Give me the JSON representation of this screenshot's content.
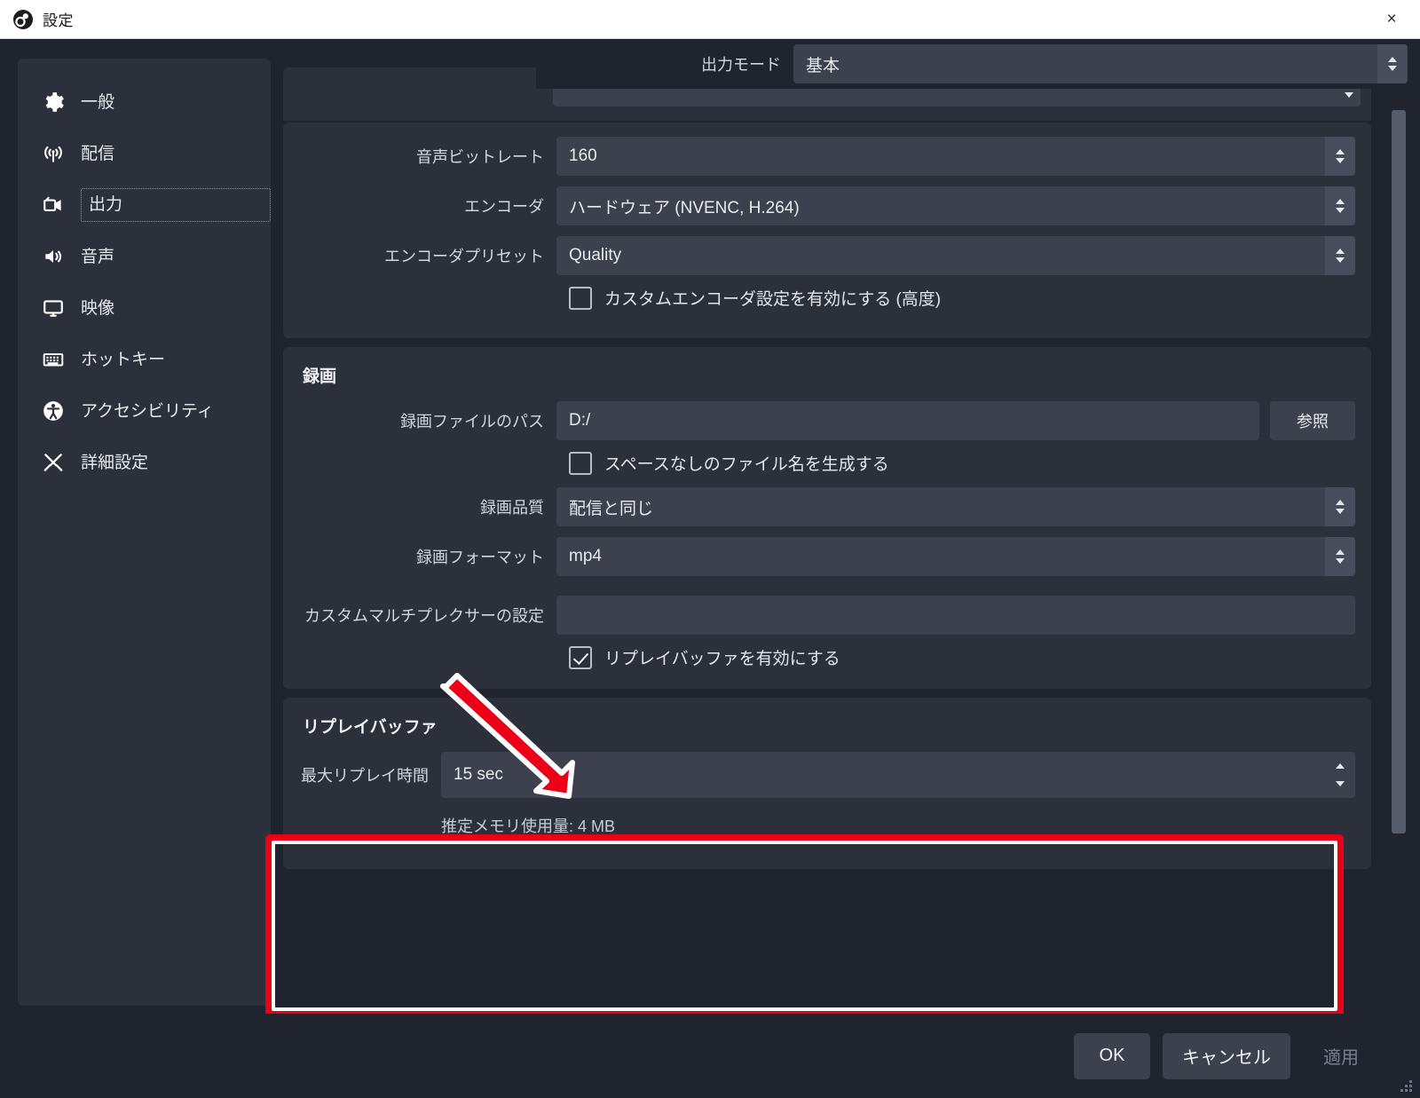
{
  "window": {
    "title": "設定",
    "app_icon": "obs-logo-icon",
    "close_label": "×"
  },
  "sidebar": {
    "items": [
      {
        "label": "一般",
        "icon": "gear-icon",
        "selected": false
      },
      {
        "label": "配信",
        "icon": "broadcast-icon",
        "selected": false
      },
      {
        "label": "出力",
        "icon": "output-camera-icon",
        "selected": true
      },
      {
        "label": "音声",
        "icon": "speaker-icon",
        "selected": false
      },
      {
        "label": "映像",
        "icon": "monitor-icon",
        "selected": false
      },
      {
        "label": "ホットキー",
        "icon": "keyboard-icon",
        "selected": false
      },
      {
        "label": "アクセシビリティ",
        "icon": "accessibility-icon",
        "selected": false
      },
      {
        "label": "詳細設定",
        "icon": "tools-icon",
        "selected": false
      }
    ]
  },
  "output_mode": {
    "label": "出力モード",
    "value": "基本"
  },
  "streaming_group": {
    "audio_bitrate": {
      "label": "音声ビットレート",
      "value": "160"
    },
    "encoder": {
      "label": "エンコーダ",
      "value": "ハードウェア (NVENC, H.264)"
    },
    "encoder_preset": {
      "label": "エンコーダプリセット",
      "value": "Quality"
    },
    "custom_encoder": {
      "label": "カスタムエンコーダ設定を有効にする (高度)",
      "checked": false
    }
  },
  "recording_group": {
    "title": "録画",
    "path": {
      "label": "録画ファイルのパス",
      "value": "D:/",
      "browse_label": "参照"
    },
    "no_space_filename": {
      "label": "スペースなしのファイル名を生成する",
      "checked": false
    },
    "quality": {
      "label": "録画品質",
      "value": "配信と同じ"
    },
    "format": {
      "label": "録画フォーマット",
      "value": "mp4"
    },
    "custom_muxer": {
      "label": "カスタムマルチプレクサーの設定",
      "value": ""
    },
    "enable_replay_buffer": {
      "label": "リプレイバッファを有効にする",
      "checked": true
    }
  },
  "replay_buffer_group": {
    "title": "リプレイバッファ",
    "max_replay_time": {
      "label": "最大リプレイ時間",
      "value": "15 sec"
    },
    "memory_note": "推定メモリ使用量: 4 MB"
  },
  "footer": {
    "ok_label": "OK",
    "cancel_label": "キャンセル",
    "apply_label": "適用"
  },
  "annotations": {
    "highlight_color": "#ec0017",
    "arrow_color": "#ec0017",
    "arrow_outline": "#ffffff"
  }
}
